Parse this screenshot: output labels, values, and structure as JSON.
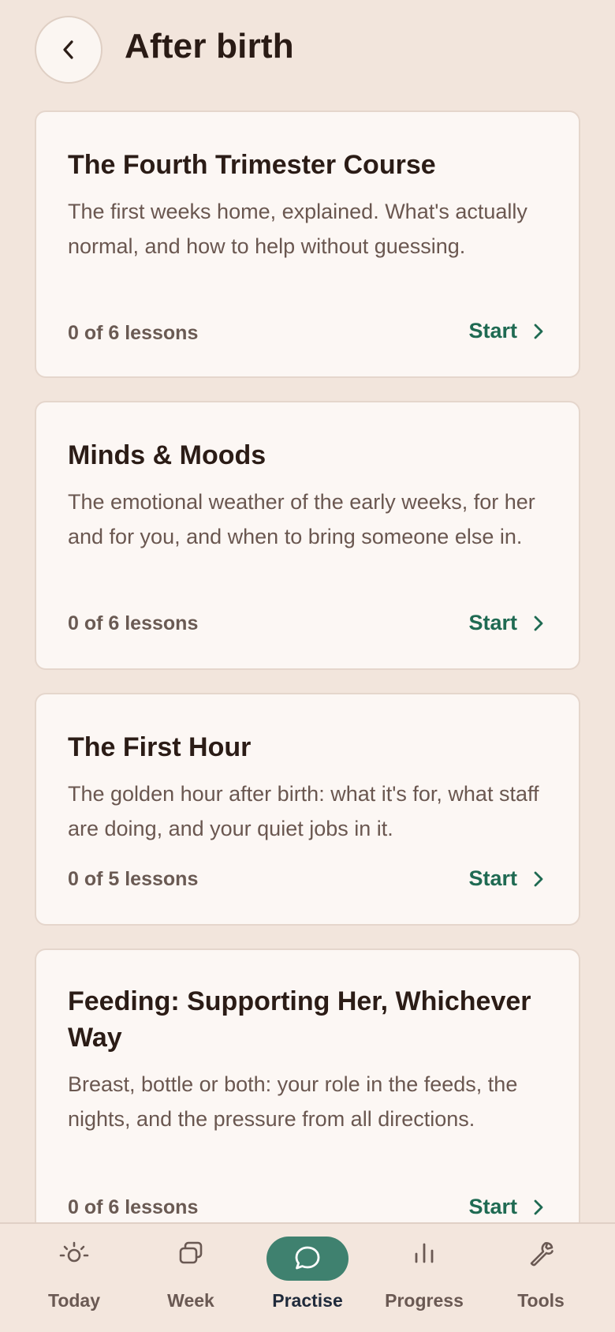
{
  "header": {
    "title": "After birth",
    "back_icon": "chevron-left-icon"
  },
  "courses": [
    {
      "title": "The Fourth Trimester Course",
      "description": "The first weeks home, explained. What's actually normal, and how to help without guessing.",
      "progress": "0 of 6 lessons",
      "action": "Start"
    },
    {
      "title": "Minds & Moods",
      "description": "The emotional weather of the early weeks, for her and for you, and when to bring someone else in.",
      "progress": "0 of 6 lessons",
      "action": "Start"
    },
    {
      "title": "The First Hour",
      "description": "The golden hour after birth: what it's for, what staff are doing, and your quiet jobs in it.",
      "progress": "0 of 5 lessons",
      "action": "Start"
    },
    {
      "title": "Feeding: Supporting Her, Whichever Way",
      "description": "Breast, bottle or both: your role in the feeds, the nights, and the pressure from all directions.",
      "progress": "0 of 6 lessons",
      "action": "Start"
    }
  ],
  "nav": [
    {
      "label": "Today",
      "icon": "sun-icon",
      "active": false
    },
    {
      "label": "Week",
      "icon": "stacked-cards-icon",
      "active": false
    },
    {
      "label": "Practise",
      "icon": "speech-bubble-icon",
      "active": true
    },
    {
      "label": "Progress",
      "icon": "bar-chart-icon",
      "active": false
    },
    {
      "label": "Tools",
      "icon": "wrench-icon",
      "active": false
    }
  ],
  "colors": {
    "background": "#f2e5dc",
    "card": "#fcf7f4",
    "accent": "#1f6a52",
    "active_pill": "#3f816f"
  }
}
